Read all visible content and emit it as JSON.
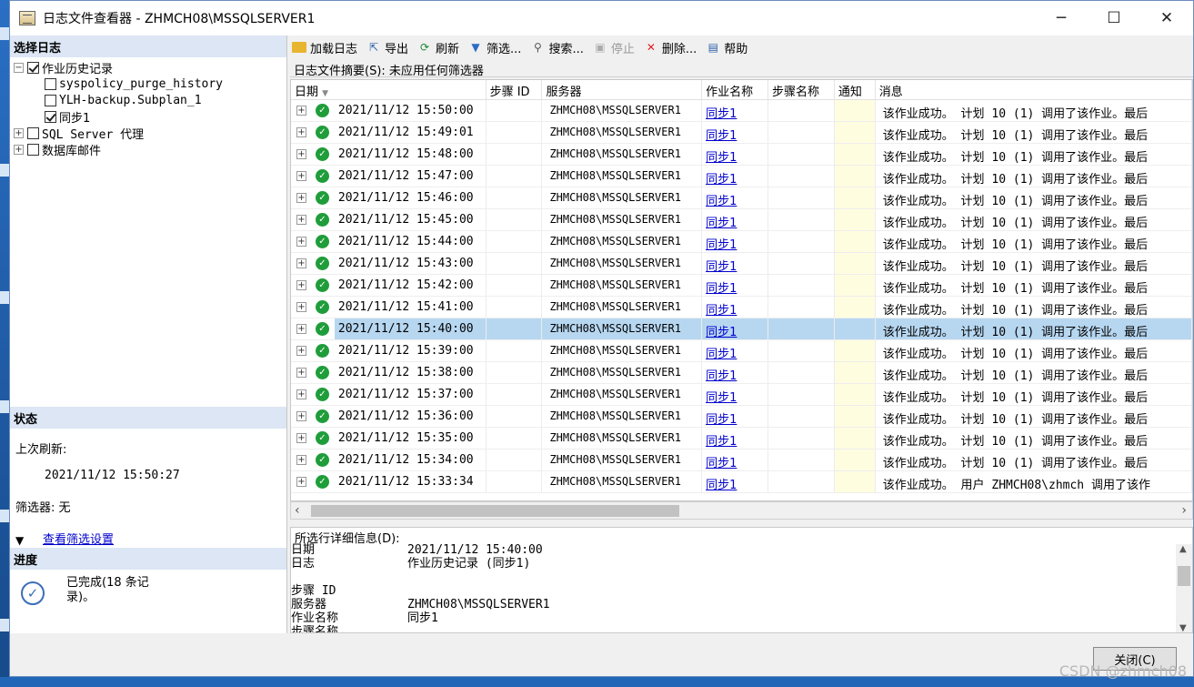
{
  "window": {
    "title": "日志文件查看器 - ZHMCH08\\MSSQLSERVER1",
    "minimize": "─",
    "maximize": "☐",
    "close": "✕"
  },
  "left": {
    "select_log_title": "选择日志",
    "tree": {
      "job_history": "作业历史记录",
      "job1": "syspolicy_purge_history",
      "job2": "YLH-backup.Subplan_1",
      "job3": "同步1",
      "sql_agent": "SQL Server 代理",
      "db_mail": "数据库邮件"
    },
    "status_title": "状态",
    "last_refresh_label": "上次刷新:",
    "last_refresh_value": "2021/11/12 15:50:27",
    "filter_label": "筛选器: 无",
    "view_filter_link": "查看筛选设置",
    "progress_title": "进度",
    "progress_text": "已完成(18 条记录)。"
  },
  "toolbar": {
    "load_log": "加载日志",
    "export": "导出",
    "refresh": "刷新",
    "filter": "筛选...",
    "search": "搜索...",
    "stop": "停止",
    "delete": "删除...",
    "help": "帮助"
  },
  "summary": {
    "label": "日志文件摘要(S): 未应用任何筛选器"
  },
  "grid": {
    "columns": {
      "date": "日期",
      "step_id": "步骤 ID",
      "server": "服务器",
      "job_name": "作业名称",
      "step_name": "步骤名称",
      "notify": "通知",
      "message": "消息"
    },
    "rows": [
      {
        "date": "2021/11/12 15:50:00",
        "server": "ZHMCH08\\MSSQLSERVER1",
        "job": "同步1",
        "message": "该作业成功。  计划 10 (1) 调用了该作业。最后"
      },
      {
        "date": "2021/11/12 15:49:01",
        "server": "ZHMCH08\\MSSQLSERVER1",
        "job": "同步1",
        "message": "该作业成功。  计划 10 (1) 调用了该作业。最后"
      },
      {
        "date": "2021/11/12 15:48:00",
        "server": "ZHMCH08\\MSSQLSERVER1",
        "job": "同步1",
        "message": "该作业成功。  计划 10 (1) 调用了该作业。最后"
      },
      {
        "date": "2021/11/12 15:47:00",
        "server": "ZHMCH08\\MSSQLSERVER1",
        "job": "同步1",
        "message": "该作业成功。  计划 10 (1) 调用了该作业。最后"
      },
      {
        "date": "2021/11/12 15:46:00",
        "server": "ZHMCH08\\MSSQLSERVER1",
        "job": "同步1",
        "message": "该作业成功。  计划 10 (1) 调用了该作业。最后"
      },
      {
        "date": "2021/11/12 15:45:00",
        "server": "ZHMCH08\\MSSQLSERVER1",
        "job": "同步1",
        "message": "该作业成功。  计划 10 (1) 调用了该作业。最后"
      },
      {
        "date": "2021/11/12 15:44:00",
        "server": "ZHMCH08\\MSSQLSERVER1",
        "job": "同步1",
        "message": "该作业成功。  计划 10 (1) 调用了该作业。最后"
      },
      {
        "date": "2021/11/12 15:43:00",
        "server": "ZHMCH08\\MSSQLSERVER1",
        "job": "同步1",
        "message": "该作业成功。  计划 10 (1) 调用了该作业。最后"
      },
      {
        "date": "2021/11/12 15:42:00",
        "server": "ZHMCH08\\MSSQLSERVER1",
        "job": "同步1",
        "message": "该作业成功。  计划 10 (1) 调用了该作业。最后"
      },
      {
        "date": "2021/11/12 15:41:00",
        "server": "ZHMCH08\\MSSQLSERVER1",
        "job": "同步1",
        "message": "该作业成功。  计划 10 (1) 调用了该作业。最后"
      },
      {
        "date": "2021/11/12 15:40:00",
        "server": "ZHMCH08\\MSSQLSERVER1",
        "job": "同步1",
        "message": "该作业成功。  计划 10 (1) 调用了该作业。最后",
        "selected": true
      },
      {
        "date": "2021/11/12 15:39:00",
        "server": "ZHMCH08\\MSSQLSERVER1",
        "job": "同步1",
        "message": "该作业成功。  计划 10 (1) 调用了该作业。最后"
      },
      {
        "date": "2021/11/12 15:38:00",
        "server": "ZHMCH08\\MSSQLSERVER1",
        "job": "同步1",
        "message": "该作业成功。  计划 10 (1) 调用了该作业。最后"
      },
      {
        "date": "2021/11/12 15:37:00",
        "server": "ZHMCH08\\MSSQLSERVER1",
        "job": "同步1",
        "message": "该作业成功。  计划 10 (1) 调用了该作业。最后"
      },
      {
        "date": "2021/11/12 15:36:00",
        "server": "ZHMCH08\\MSSQLSERVER1",
        "job": "同步1",
        "message": "该作业成功。  计划 10 (1) 调用了该作业。最后"
      },
      {
        "date": "2021/11/12 15:35:00",
        "server": "ZHMCH08\\MSSQLSERVER1",
        "job": "同步1",
        "message": "该作业成功。  计划 10 (1) 调用了该作业。最后"
      },
      {
        "date": "2021/11/12 15:34:00",
        "server": "ZHMCH08\\MSSQLSERVER1",
        "job": "同步1",
        "message": "该作业成功。  计划 10 (1) 调用了该作业。最后"
      },
      {
        "date": "2021/11/12 15:33:34",
        "server": "ZHMCH08\\MSSQLSERVER1",
        "job": "同步1",
        "message": "该作业成功。  用户 ZHMCH08\\zhmch 调用了该作"
      }
    ]
  },
  "details": {
    "title": "所选行详细信息(D):",
    "rows": [
      {
        "k": "日期",
        "v": "2021/11/12 15:40:00"
      },
      {
        "k": "日志",
        "v": "作业历史记录 (同步1)"
      },
      {
        "k": "",
        "v": ""
      },
      {
        "k": "步骤 ID",
        "v": ""
      },
      {
        "k": "服务器",
        "v": "ZHMCH08\\MSSQLSERVER1"
      },
      {
        "k": "作业名称",
        "v": "同步1"
      },
      {
        "k": "步骤名称",
        "v": ""
      }
    ]
  },
  "close_button": "关闭(C)",
  "watermark": "CSDN @zhmch08"
}
